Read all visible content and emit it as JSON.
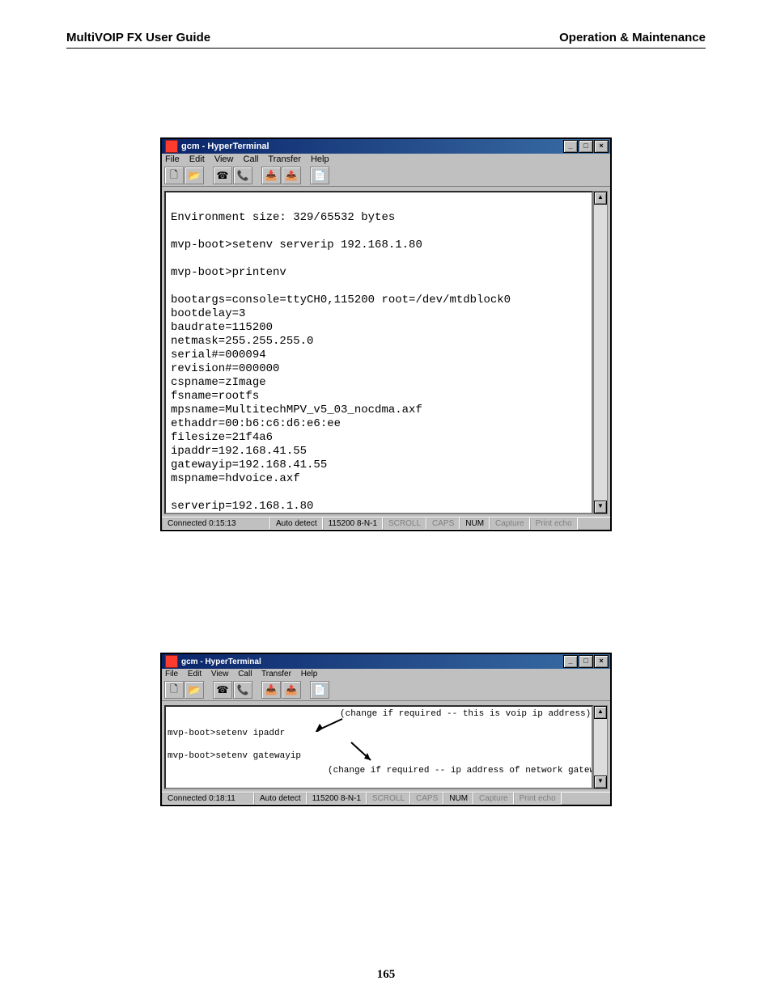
{
  "header": {
    "left": "MultiVOIP FX User Guide",
    "right": "Operation & Maintenance"
  },
  "page_number": "165",
  "window1": {
    "title": "gcm - HyperTerminal",
    "menu": [
      "File",
      "Edit",
      "View",
      "Call",
      "Transfer",
      "Help"
    ],
    "terminal": "\nEnvironment size: 329/65532 bytes\n\nmvp-boot>setenv serverip 192.168.1.80\n\nmvp-boot>printenv\n\nbootargs=console=ttyCH0,115200 root=/dev/mtdblock0\nbootdelay=3\nbaudrate=115200\nnetmask=255.255.255.0\nserial#=000094\nrevision#=000000\ncspname=zImage\nfsname=rootfs\nmpsname=MultitechMPV_v5_03_nocdma.axf\nethaddr=00:b6:c6:d6:e6:ee\nfilesize=21f4a6\nipaddr=192.168.41.55\ngatewayip=192.168.41.55\nmspname=hdvoice.axf\n\nserverip=192.168.1.80\n",
    "status": {
      "connected": "Connected 0:15:13",
      "detect": "Auto detect",
      "settings": "115200 8-N-1",
      "scroll": "SCROLL",
      "caps": "CAPS",
      "num": "NUM",
      "capture": "Capture",
      "printecho": "Print echo"
    }
  },
  "window2": {
    "title": "gcm - HyperTerminal",
    "menu": [
      "File",
      "Edit",
      "View",
      "Call",
      "Transfer",
      "Help"
    ],
    "prompt1": "mvp-boot>setenv ipaddr",
    "prompt2": "mvp-boot>setenv gatewayip",
    "note1": "(change if required -- this is voip ip address)",
    "note2": "(change if required -- ip address of network gateway)",
    "status": {
      "connected": "Connected 0:18:11",
      "detect": "Auto detect",
      "settings": "115200 8-N-1",
      "scroll": "SCROLL",
      "caps": "CAPS",
      "num": "NUM",
      "capture": "Capture",
      "printecho": "Print echo"
    }
  },
  "win_controls": {
    "min": "_",
    "max": "□",
    "close": "×"
  },
  "scroll": {
    "up": "▲",
    "down": "▼"
  },
  "icons": {
    "new": "🗋",
    "open": "📂",
    "phone": "☎",
    "hang": "📞",
    "send": "📥",
    "recv": "📤",
    "props": "📄"
  }
}
